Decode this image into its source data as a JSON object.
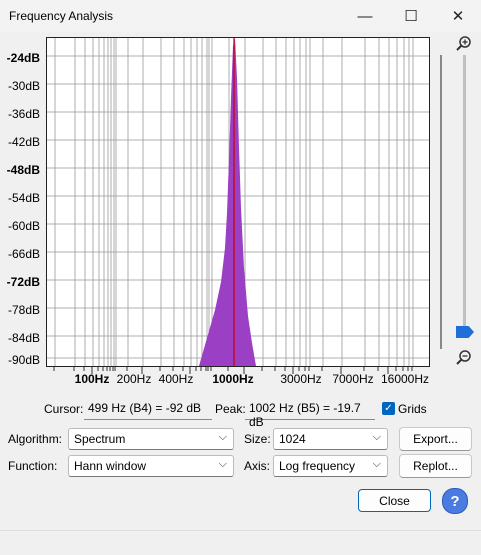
{
  "window": {
    "title": "Frequency Analysis",
    "minimize": "—",
    "maximize": "☐",
    "close": "✕"
  },
  "plot": {
    "y_labels": [
      {
        "text": "-24dB",
        "bold": true
      },
      {
        "text": "-30dB",
        "bold": false
      },
      {
        "text": "-36dB",
        "bold": false
      },
      {
        "text": "-42dB",
        "bold": false
      },
      {
        "text": "-48dB",
        "bold": true
      },
      {
        "text": "-54dB",
        "bold": false
      },
      {
        "text": "-60dB",
        "bold": false
      },
      {
        "text": "-66dB",
        "bold": false
      },
      {
        "text": "-72dB",
        "bold": true
      },
      {
        "text": "-78dB",
        "bold": false
      },
      {
        "text": "-84dB",
        "bold": false
      },
      {
        "text": "-90dB",
        "bold": false
      }
    ],
    "x_labels": [
      {
        "text": "100Hz",
        "bold": true
      },
      {
        "text": "200Hz",
        "bold": false
      },
      {
        "text": "400Hz",
        "bold": false
      },
      {
        "text": "1000Hz",
        "bold": true
      },
      {
        "text": "3000Hz",
        "bold": false
      },
      {
        "text": "7000Hz",
        "bold": false
      },
      {
        "text": "16000Hz",
        "bold": false
      }
    ],
    "spectrum_color": "#9b3fc4",
    "cursor_line_color": "#cc0000",
    "grid_color": "#999999"
  },
  "zoom": {
    "in_icon": "zoom-in-icon",
    "out_icon": "zoom-out-icon",
    "level": 0.93
  },
  "readout": {
    "cursor_label": "Cursor:",
    "cursor_value": "499 Hz (B4) = -92 dB",
    "peak_label": "Peak:",
    "peak_value": "1002 Hz (B5) = -19.7 dB",
    "grids_label": "Grids",
    "grids_checked": true
  },
  "controls": {
    "algorithm_label": "Algorithm:",
    "algorithm_value": "Spectrum",
    "size_label": "Size:",
    "size_value": "1024",
    "export_label": "Export...",
    "function_label": "Function:",
    "function_value": "Hann window",
    "axis_label": "Axis:",
    "axis_value": "Log frequency",
    "replot_label": "Replot..."
  },
  "footer": {
    "close_label": "Close",
    "help_label": "?"
  }
}
